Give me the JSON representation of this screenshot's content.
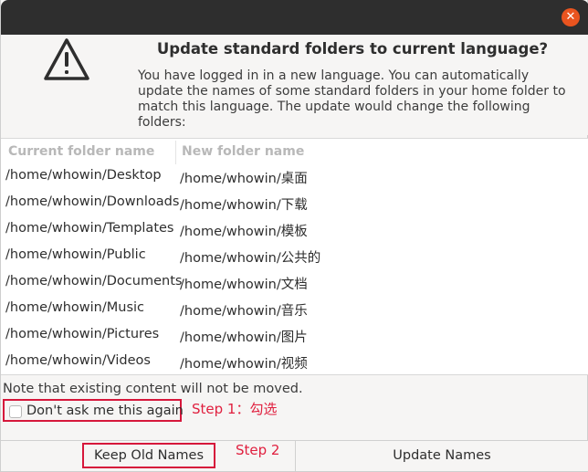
{
  "window": {
    "close_glyph": "✕"
  },
  "dialog": {
    "title": "Update standard folders to current language?",
    "description": "You have logged in in a new language. You can automatically update the names of some standard folders in your home folder to match this language. The update would change the following folders:",
    "icon": "warning-triangle-icon"
  },
  "table": {
    "headers": [
      "Current folder name",
      "New folder name"
    ],
    "rows": [
      [
        "/home/whowin/Desktop",
        "/home/whowin/桌面"
      ],
      [
        "/home/whowin/Downloads",
        "/home/whowin/下载"
      ],
      [
        "/home/whowin/Templates",
        "/home/whowin/模板"
      ],
      [
        "/home/whowin/Public",
        "/home/whowin/公共的"
      ],
      [
        "/home/whowin/Documents",
        "/home/whowin/文档"
      ],
      [
        "/home/whowin/Music",
        "/home/whowin/音乐"
      ],
      [
        "/home/whowin/Pictures",
        "/home/whowin/图片"
      ],
      [
        "/home/whowin/Videos",
        "/home/whowin/视频"
      ]
    ]
  },
  "note": "Note that existing content will not be moved.",
  "checkbox": {
    "label": "Don't ask me this again",
    "checked": false
  },
  "annotations": {
    "step1": "Step 1：勾选",
    "step2": "Step 2",
    "highlight_color": "#d6173b"
  },
  "buttons": {
    "keep": "Keep Old Names",
    "update": "Update Names"
  },
  "colors": {
    "titlebar": "#2e2e2e",
    "close": "#e9541f"
  }
}
